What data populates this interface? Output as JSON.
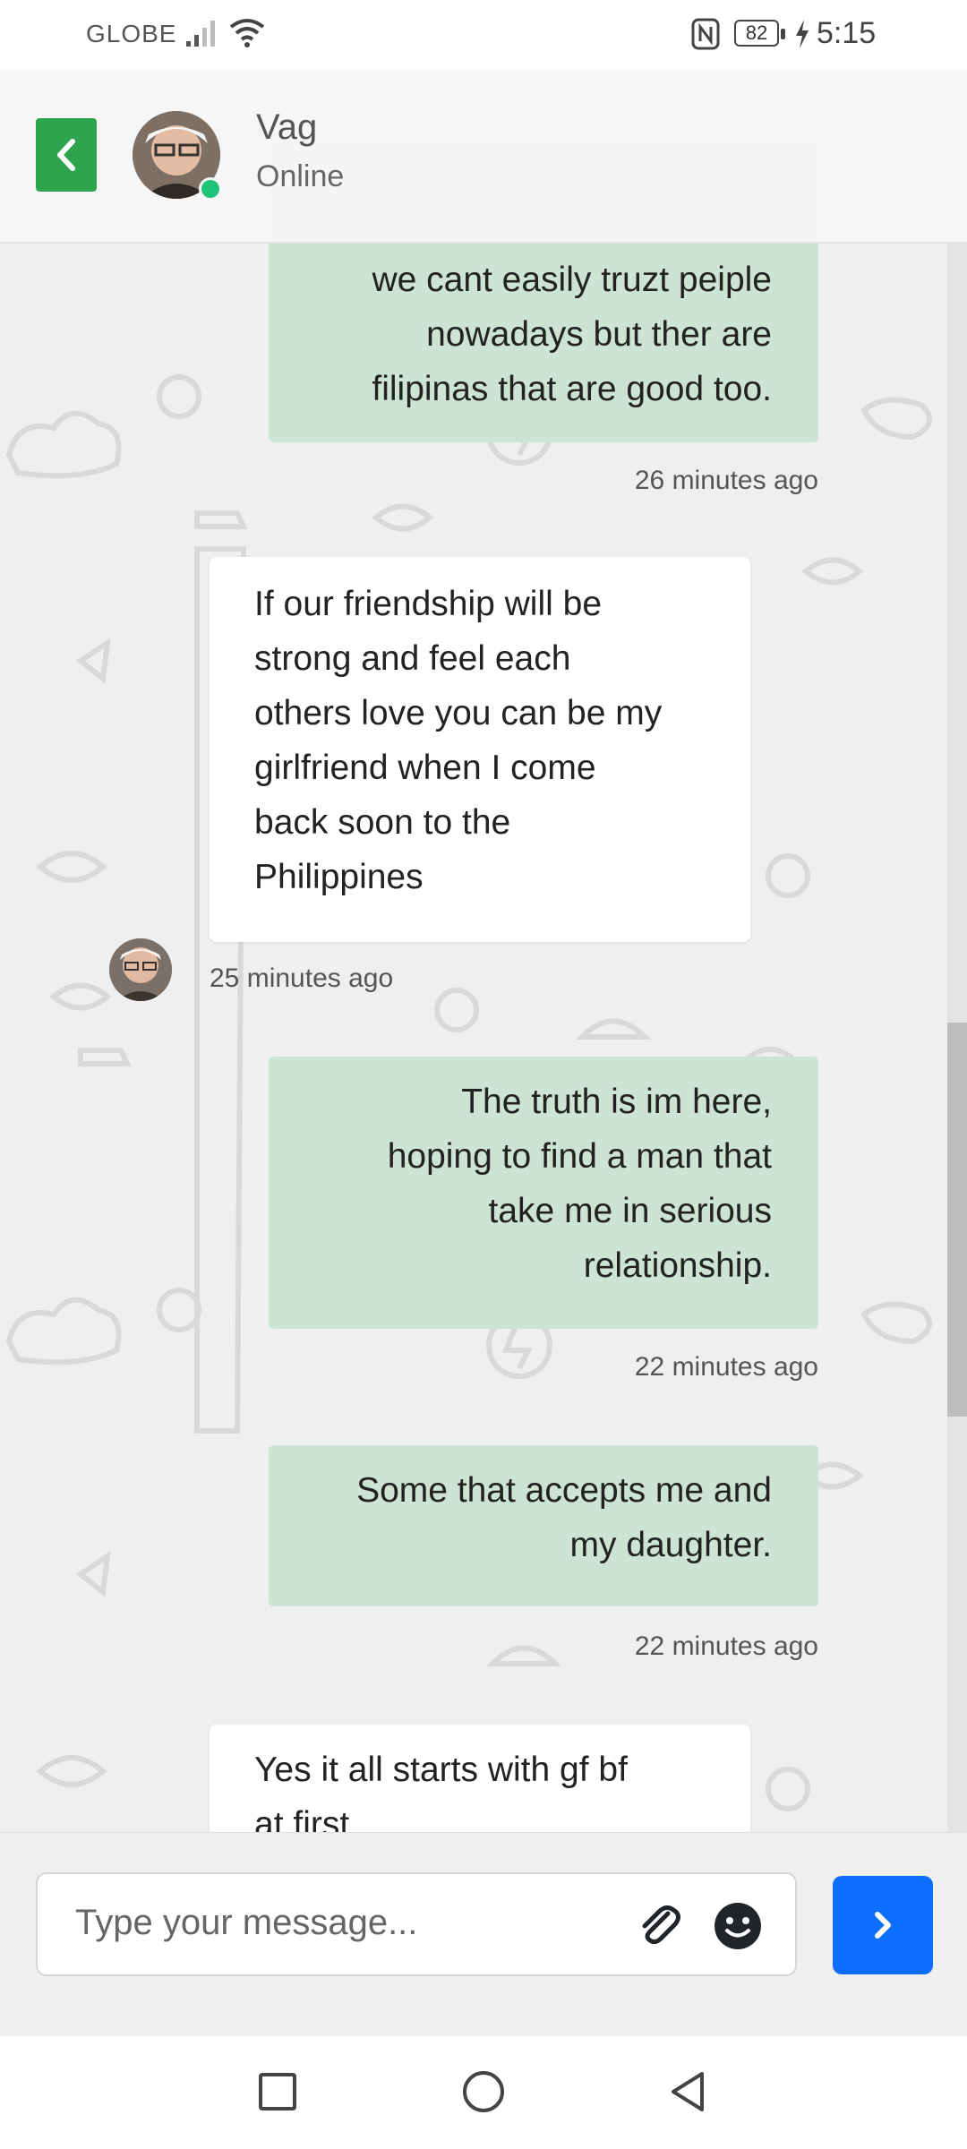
{
  "status_bar": {
    "carrier": "GLOBE",
    "battery": "82",
    "time": "5:15"
  },
  "header": {
    "contact_name": "Vag",
    "contact_status": "Online"
  },
  "messages": [
    {
      "direction": "outgoing",
      "lines": [
        "we cant easily truzt peiple",
        "nowadays but ther are",
        "filipinas that are good too."
      ],
      "time": "26 minutes ago"
    },
    {
      "direction": "incoming",
      "lines": [
        "If our friendship will be",
        "strong and feel each",
        "others love you can be my",
        "girlfriend when I come",
        "back soon to the",
        "Philippines"
      ],
      "time": "25 minutes ago"
    },
    {
      "direction": "outgoing",
      "lines": [
        "The truth is im here,",
        "hoping to find a man that",
        "take me in serious",
        "relationship."
      ],
      "time": "22 minutes ago"
    },
    {
      "direction": "outgoing",
      "lines": [
        "Some that accepts me and",
        "my daughter."
      ],
      "time": "22 minutes ago"
    },
    {
      "direction": "incoming",
      "lines": [
        "Yes it all starts with gf bf",
        "at first"
      ],
      "time": ""
    }
  ],
  "composer": {
    "placeholder": "Type your message..."
  },
  "colors": {
    "outgoing_bubble": "#cde3d3",
    "incoming_bubble": "#ffffff",
    "back_button": "#2ea44f",
    "send_button": "#0d6efd",
    "online_indicator": "#1fc47a"
  },
  "icons": {
    "back": "chevron-left-icon",
    "attach": "paperclip-icon",
    "emoji": "smiley-icon",
    "send": "chevron-right-icon",
    "nav": [
      "square-icon",
      "circle-icon",
      "triangle-back-icon"
    ]
  }
}
